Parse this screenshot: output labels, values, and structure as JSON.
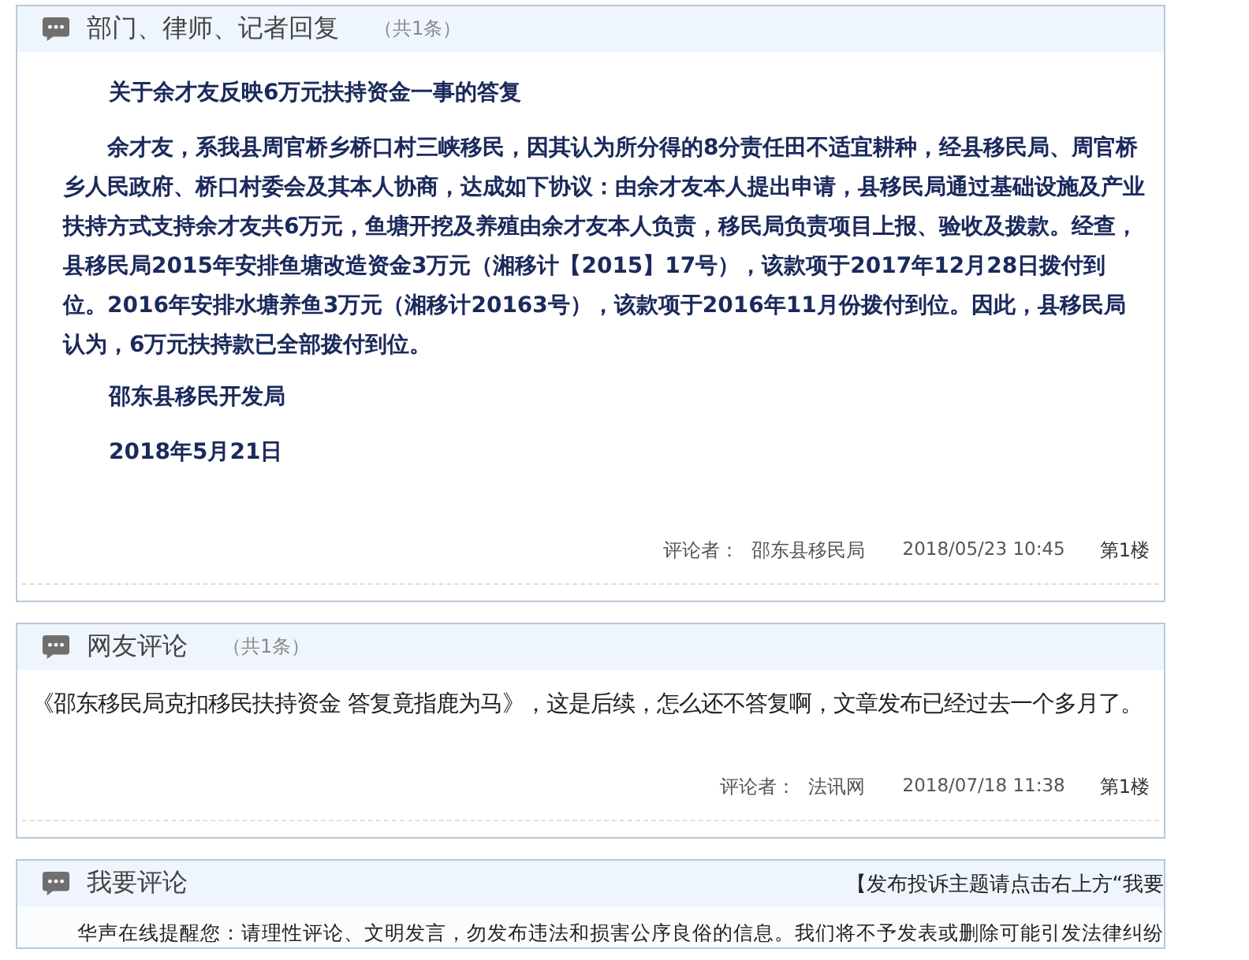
{
  "sections": [
    {
      "title": "部门、律师、记者回复",
      "count": "（共1条）",
      "paragraphs": [
        {
          "kind": "heading",
          "text": "关于余才友反映6万元扶持资金一事的答复"
        },
        {
          "kind": "body",
          "text": "余才友，系我县周官桥乡桥口村三峡移民，因其认为所分得的8分责任田不适宜耕种，经县移民局、周官桥乡人民政府、桥口村委会及其本人协商，达成如下协议：由余才友本人提出申请，县移民局通过基础设施及产业扶持方式支持余才友共6万元，鱼塘开挖及养殖由余才友本人负责，移民局负责项目上报、验收及拨款。经查，县移民局2015年安排鱼塘改造资金3万元（湘移计【2015】17号），该款项于2017年12月28日拨付到位。2016年安排水塘养鱼3万元（湘移计20163号），该款项于2016年11月份拨付到位。因此，县移民局认为，6万元扶持款已全部拨付到位。"
        },
        {
          "kind": "heading",
          "text": "邵东县移民开发局"
        },
        {
          "kind": "heading",
          "text": "2018年5月21日"
        }
      ],
      "meta": {
        "label": "评论者：",
        "author": "邵东县移民局",
        "time": "2018/05/23 10:45",
        "floor": "第1楼"
      }
    },
    {
      "title": "网友评论",
      "count": "（共1条）",
      "paragraphs": [
        {
          "kind": "plain",
          "text": "《邵东移民局克扣移民扶持资金 答复竟指鹿为马》，这是后续，怎么还不答复啊，文章发布已经过去一个多月了。"
        }
      ],
      "meta": {
        "label": "评论者：",
        "author": "法讯网",
        "time": "2018/07/18 11:38",
        "floor": "第1楼"
      }
    },
    {
      "title": "我要评论",
      "hint": "【发布投诉主题请点击右上方“我要",
      "notice": "华声在线提醒您：请理性评论、文明发言，勿发布违法和损害公序良俗的信息。我们将不予发表或删除可能引发法律纠纷"
    }
  ]
}
